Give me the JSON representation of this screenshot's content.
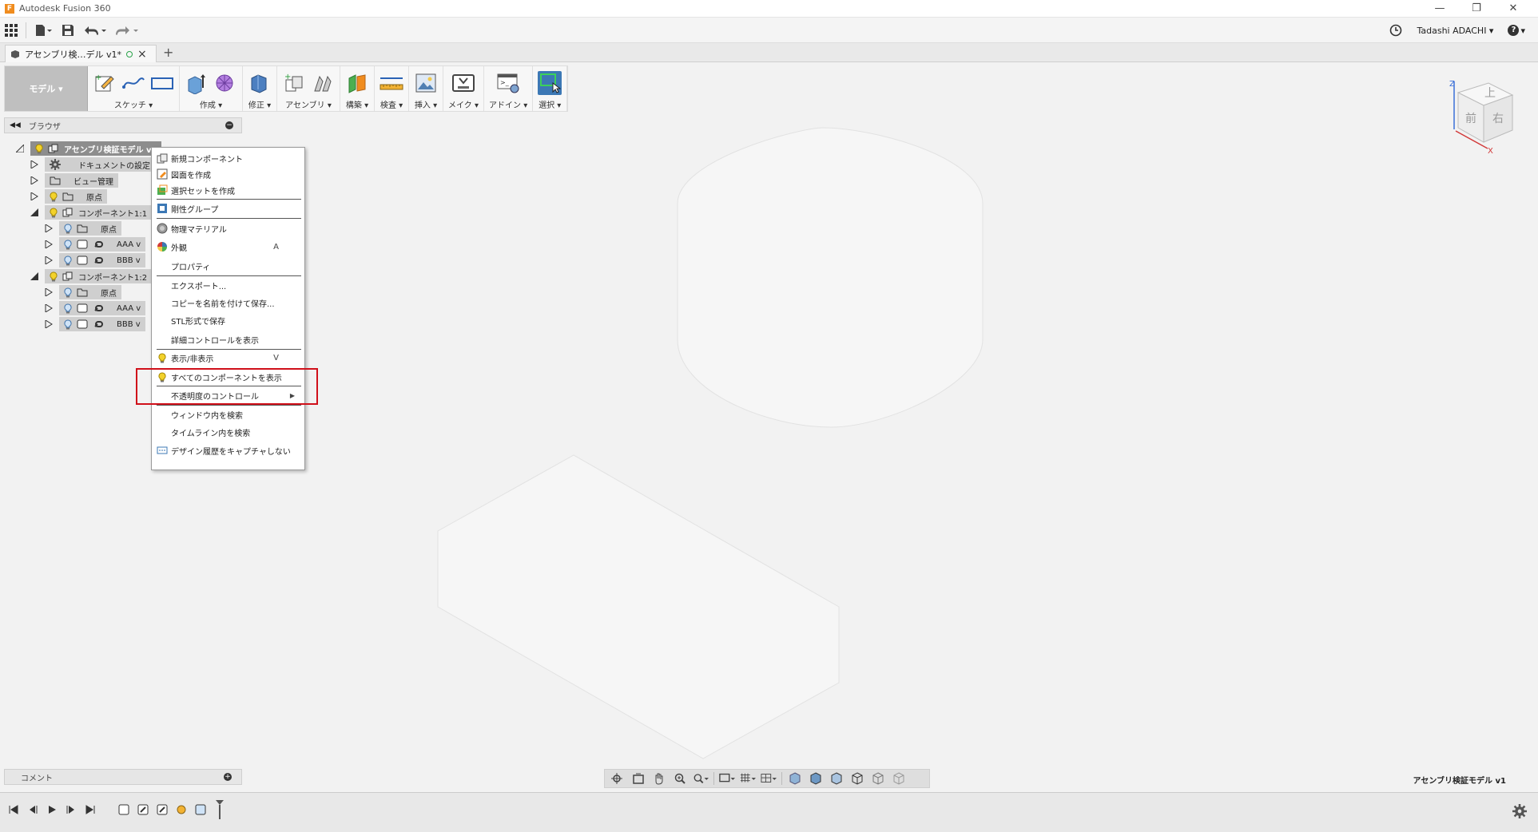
{
  "window": {
    "title": "Autodesk Fusion 360",
    "controls": [
      "—",
      "❐",
      "✕"
    ]
  },
  "quick_access": {
    "user": "Tadashi ADACHI",
    "help": "?"
  },
  "doc_tab": {
    "name": "アセンブリ検…デル v1*",
    "close": "×",
    "add": "+"
  },
  "toolbar": {
    "workspace": "モデル",
    "groups": [
      {
        "label": "スケッチ",
        "icons": [
          "sketch-create-icon",
          "spline-icon",
          "rectangle-icon"
        ]
      },
      {
        "label": "作成",
        "icons": [
          "extrude-icon",
          "form-icon"
        ]
      },
      {
        "label": "修正",
        "icons": [
          "press-pull-icon"
        ]
      },
      {
        "label": "アセンブリ",
        "icons": [
          "new-component-icon",
          "joint-icon"
        ]
      },
      {
        "label": "構築",
        "icons": [
          "plane-icon"
        ]
      },
      {
        "label": "検査",
        "icons": [
          "measure-icon"
        ]
      },
      {
        "label": "挿入",
        "icons": [
          "insert-image-icon"
        ]
      },
      {
        "label": "メイク",
        "icons": [
          "make-icon"
        ]
      },
      {
        "label": "アドイン",
        "icons": [
          "addin-icon"
        ]
      },
      {
        "label": "選択",
        "icons": [
          "select-icon"
        ]
      }
    ]
  },
  "browser": {
    "title": "ブラウザ",
    "tree": [
      {
        "label": "アセンブリ検証モデル v1",
        "level": 0,
        "expanded": true,
        "root": true
      },
      {
        "label": "ドキュメントの設定",
        "level": 1,
        "expanded": false,
        "icon": "gear"
      },
      {
        "label": "ビュー管理",
        "level": 1,
        "expanded": false,
        "icon": "folder"
      },
      {
        "label": "原点",
        "level": 1,
        "expanded": false,
        "icon": "folder",
        "bulb": true
      },
      {
        "label": "コンポーネント1:1",
        "level": 1,
        "expanded": true,
        "icon": "component",
        "bulb": true
      },
      {
        "label": "原点",
        "level": 2,
        "expanded": false,
        "icon": "folder",
        "bulb": true
      },
      {
        "label": "AAA v",
        "level": 2,
        "expanded": false,
        "icon": "body-link",
        "bulb": true
      },
      {
        "label": "BBB v",
        "level": 2,
        "expanded": false,
        "icon": "body-link",
        "bulb": true
      },
      {
        "label": "コンポーネント1:2",
        "level": 1,
        "expanded": true,
        "icon": "component",
        "bulb": true
      },
      {
        "label": "原点",
        "level": 2,
        "expanded": false,
        "icon": "folder",
        "bulb": true
      },
      {
        "label": "AAA v",
        "level": 2,
        "expanded": false,
        "icon": "body-link",
        "bulb": true
      },
      {
        "label": "BBB v",
        "level": 2,
        "expanded": false,
        "icon": "body-link",
        "bulb": true
      }
    ]
  },
  "context_menu": {
    "items": [
      {
        "label": "新規コンポーネント",
        "icon": "new-component-icon"
      },
      {
        "label": "図面を作成",
        "icon": "drawing-icon"
      },
      {
        "label": "選択セットを作成",
        "icon": "selection-set-icon"
      },
      {
        "sep": true
      },
      {
        "label": "剛性グループ",
        "icon": "rigid-group-icon"
      },
      {
        "sep": true
      },
      {
        "label": "物理マテリアル",
        "icon": "material-icon"
      },
      {
        "label": "外観",
        "icon": "appearance-icon",
        "shortcut": "A"
      },
      {
        "label": "プロパティ",
        "icon": ""
      },
      {
        "sep": true
      },
      {
        "label": "エクスポート...",
        "icon": ""
      },
      {
        "label": "コピーを名前を付けて保存...",
        "icon": ""
      },
      {
        "label": "STL形式で保存",
        "icon": ""
      },
      {
        "label": "詳細コントロールを表示",
        "icon": ""
      },
      {
        "sep": true
      },
      {
        "label": "表示/非表示",
        "icon": "bulb-icon",
        "shortcut": "V"
      },
      {
        "label": "すべてのコンポーネントを表示",
        "icon": "bulb-icon"
      },
      {
        "sep": true
      },
      {
        "label": "不透明度のコントロール",
        "icon": "",
        "submenu": true
      },
      {
        "sep": true
      },
      {
        "label": "ウィンドウ内を検索",
        "icon": ""
      },
      {
        "label": "タイムライン内を検索",
        "icon": ""
      },
      {
        "label": "デザイン履歴をキャプチャしない",
        "icon": "history-icon"
      }
    ]
  },
  "comment": {
    "title": "コメント"
  },
  "viewcube": {
    "top": "上",
    "front": "前",
    "right": "右",
    "x": "X",
    "z": "Z"
  },
  "document_name": "アセンブリ検証モデル v1",
  "colors": {
    "accent": "#3c78b5",
    "highlight": "#d0101a",
    "bulb": "#f3d22b"
  }
}
